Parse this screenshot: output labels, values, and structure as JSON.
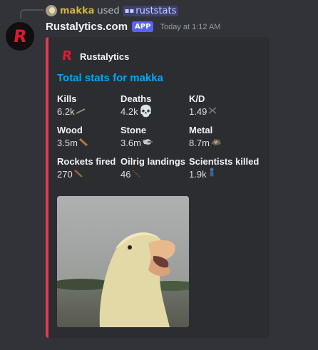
{
  "reply": {
    "username": "makka",
    "used_text": "used",
    "command": "ruststats"
  },
  "message": {
    "author": "Rustalytics.com",
    "badge": "APP",
    "timestamp": "Today at 1:12 AM"
  },
  "embed": {
    "accent_color": "#e03b4f",
    "author_name": "Rustalytics",
    "title": "Total stats for makka",
    "fields": [
      {
        "name": "Kills",
        "value": "6.2k",
        "icon": "rifle-emoji"
      },
      {
        "name": "Deaths",
        "value": "4.2k",
        "icon": "skull-emoji"
      },
      {
        "name": "K/D",
        "value": "1.49",
        "icon": "crossed-swords-emoji"
      },
      {
        "name": "Wood",
        "value": "3.5m",
        "icon": "wood-emoji"
      },
      {
        "name": "Stone",
        "value": "3.6m",
        "icon": "stone-emoji"
      },
      {
        "name": "Metal",
        "value": "8.7m",
        "icon": "metal-ore-emoji"
      },
      {
        "name": "Rockets fired",
        "value": "270",
        "icon": "rocket-emoji"
      },
      {
        "name": "Oilrig landings",
        "value": "46",
        "icon": "rope-emoji"
      },
      {
        "name": "Scientists killed",
        "value": "1.9k",
        "icon": "scientist-emoji"
      }
    ],
    "image": "duckling-photo"
  }
}
